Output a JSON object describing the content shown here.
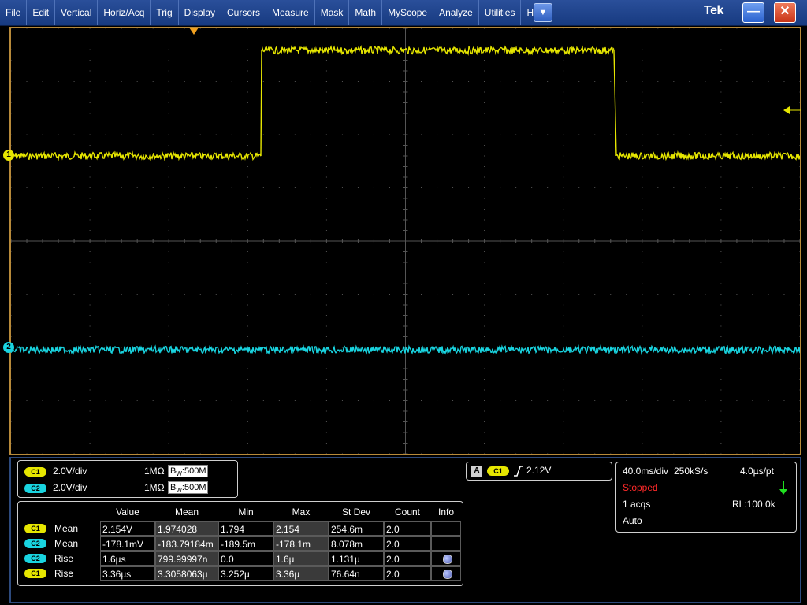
{
  "menu": {
    "items": [
      "File",
      "Edit",
      "Vertical",
      "Horiz/Acq",
      "Trig",
      "Display",
      "Cursors",
      "Measure",
      "Mask",
      "Math",
      "MyScope",
      "Analyze",
      "Utilities",
      "Help"
    ],
    "dropdown_icon": "chevron-down-icon",
    "brand": "Tek"
  },
  "colors": {
    "ch1": "#e6e600",
    "ch2": "#19d4e0",
    "graticule": "#555555",
    "frame": "#b88a3a"
  },
  "channels": {
    "c1": {
      "chip": "C1",
      "marker": "1",
      "scale": "2.0V/div",
      "impedance": "1MΩ",
      "bw_prefix": "B",
      "bw_sub": "W",
      "bw_value": ":500M"
    },
    "c2": {
      "chip": "C2",
      "marker": "2",
      "scale": "2.0V/div",
      "impedance": "1MΩ",
      "bw_prefix": "B",
      "bw_sub": "W",
      "bw_value": ":500M"
    }
  },
  "trigger": {
    "source_label": "A",
    "chip": "C1",
    "level": "2.12V"
  },
  "horizontal": {
    "timebase": "40.0ms/div",
    "sample_rate": "250kS/s",
    "per_point": "4.0µs/pt",
    "state": "Stopped",
    "acqs": "1 acqs",
    "record_length": "RL:100.0k",
    "mode": "Auto"
  },
  "measurements": {
    "headers": [
      "Value",
      "Mean",
      "Min",
      "Max",
      "St Dev",
      "Count",
      "Info"
    ],
    "rows": [
      {
        "chip": "C1",
        "type": "Mean",
        "value": "2.154V",
        "mean": "1.974028",
        "min": "1.794",
        "max": "2.154",
        "stdev": "254.6m",
        "count": "2.0",
        "info": false
      },
      {
        "chip": "C2",
        "type": "Mean",
        "value": "-178.1mV",
        "mean": "-183.79184m",
        "min": "-189.5m",
        "max": "-178.1m",
        "stdev": "8.078m",
        "count": "2.0",
        "info": false
      },
      {
        "chip": "C2",
        "type": "Rise",
        "value": "1.6µs",
        "mean": "799.99997n",
        "min": "0.0",
        "max": "1.6µ",
        "stdev": "1.131µ",
        "count": "2.0",
        "info": true
      },
      {
        "chip": "C1",
        "type": "Rise",
        "value": "3.36µs",
        "mean": "3.3058063µ",
        "min": "3.252µ",
        "max": "3.36µ",
        "stdev": "76.64n",
        "count": "2.0",
        "info": true
      }
    ]
  }
}
